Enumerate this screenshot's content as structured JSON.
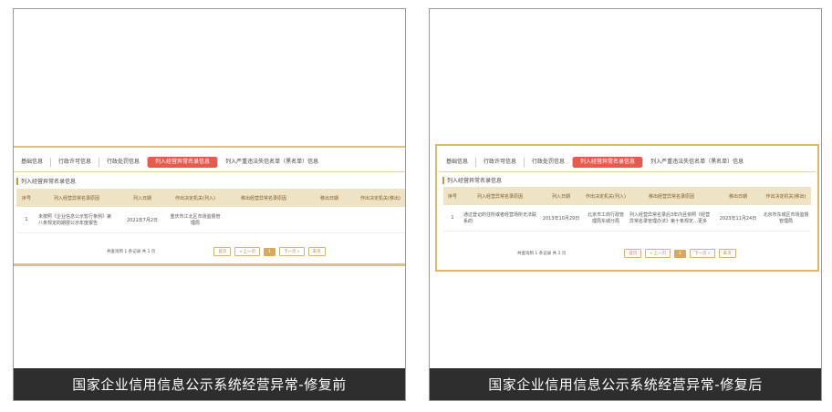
{
  "left": {
    "caption": "国家企业信用信息公示系统经营异常-修复前",
    "tabs": [
      "基础信息",
      "行政许可信息",
      "行政处罚信息",
      "列入经营异常名录信息",
      "列入严重违法失信名单（黑名单）信息"
    ],
    "section_title": "列入经营异常名录信息",
    "headers": [
      "序号",
      "列入经营异常名录原因",
      "列入日期",
      "作出决定机关(列入)",
      "移出经营异常名录原因",
      "移出日期",
      "作出决定机关(移出)"
    ],
    "row": [
      "1",
      "未按照《企业信息公示暂行条例》第八条规定的期限公示年度报告",
      "2021年7月2日",
      "重庆市江北区市场监督管理局",
      "",
      "",
      ""
    ],
    "pagination": {
      "info": "共查询到 1 条记录 共 1 页",
      "first": "首页",
      "prev": "« 上一页",
      "current": "1",
      "next": "下一页 »",
      "last": "末页"
    }
  },
  "right": {
    "caption": "国家企业信用信息公示系统经营异常-修复后",
    "tabs": [
      "基础信息",
      "行政许可信息",
      "行政处罚信息",
      "列入经营异常名录信息",
      "列入严重违法失信名单（黑名单）信息"
    ],
    "section_title": "列入经营异常名录信息",
    "headers": [
      "序号",
      "列入经营异常名录原因",
      "列入日期",
      "作出决定机关(列入)",
      "移出经营异常名录原因",
      "移出日期",
      "作出决定机关(移出)"
    ],
    "row": [
      "1",
      "通过登记的住所或者经营场所无法联系的",
      "2013年10月29日",
      "北京市工商行政管理局东城分局",
      "列入经营异常名录后3年内且依照《经营异常名录管理办法》第十条规定…更多",
      "2023年11月24日",
      "北京市东城区市场监督管理局"
    ],
    "pagination": {
      "info": "共查询到 1 条记录 共 1 页",
      "first": "首页",
      "prev": "« 上一页",
      "current": "1",
      "next": "下一页 »",
      "last": "末页"
    }
  }
}
